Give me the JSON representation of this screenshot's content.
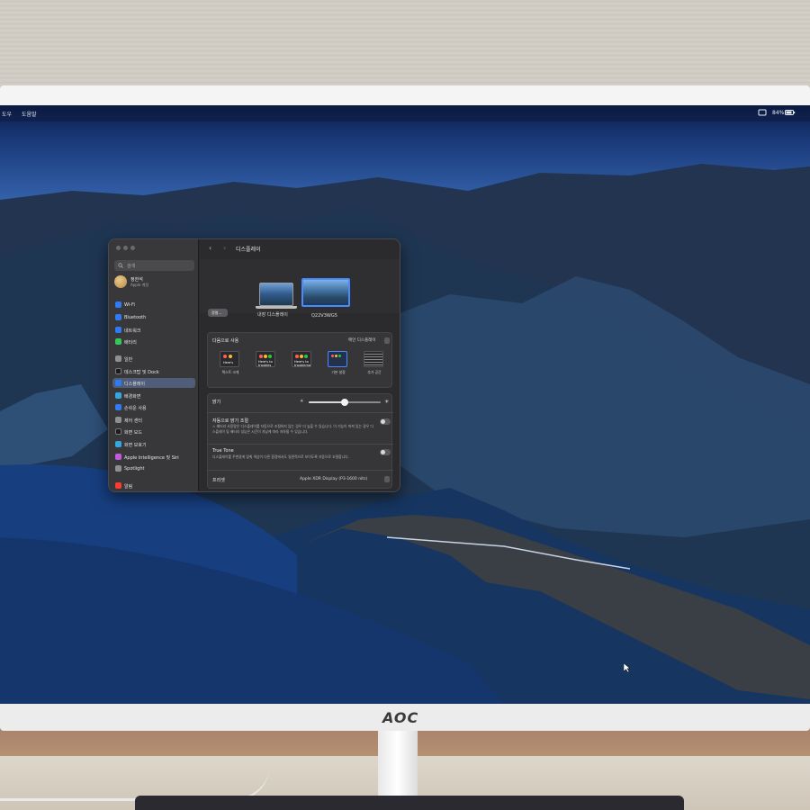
{
  "menubar": {
    "left_items": [
      "도우",
      "도움말"
    ],
    "battery": "84%",
    "icons": [
      "control-center-icon",
      "battery-icon"
    ]
  },
  "monitor": {
    "brand": "AOC"
  },
  "window": {
    "title": "디스플레이",
    "search_placeholder": "검색",
    "profile": {
      "name": "정한석",
      "subtitle": "Apple 계정"
    },
    "sidebar_items": [
      {
        "label": "Wi-Fi",
        "icon": "wifi-icon",
        "color": "#2d7cf6"
      },
      {
        "label": "Bluetooth",
        "icon": "bluetooth-icon",
        "color": "#2d7cf6"
      },
      {
        "label": "네트워크",
        "icon": "network-icon",
        "color": "#2d7cf6"
      },
      {
        "label": "배터리",
        "icon": "battery-icon",
        "color": "#34c759"
      },
      {
        "label": "일반",
        "icon": "gear-icon",
        "color": "#8e8e93"
      },
      {
        "label": "데스크탑 및 Dock",
        "icon": "dock-icon",
        "color": "#1c1c1e"
      },
      {
        "label": "디스플레이",
        "icon": "display-icon",
        "color": "#2d7cf6",
        "selected": true
      },
      {
        "label": "배경화면",
        "icon": "wallpaper-icon",
        "color": "#35a7e0"
      },
      {
        "label": "손쉬운 사용",
        "icon": "accessibility-icon",
        "color": "#2d7cf6"
      },
      {
        "label": "제어 센터",
        "icon": "control-center-icon",
        "color": "#8e8e93"
      },
      {
        "label": "화면 모드",
        "icon": "appearance-icon",
        "color": "#1c1c1e"
      },
      {
        "label": "화면 보호기",
        "icon": "screensaver-icon",
        "color": "#35a7e0"
      },
      {
        "label": "Apple Intelligence 및 Siri",
        "icon": "siri-icon",
        "color": "#c05be0"
      },
      {
        "label": "Spotlight",
        "icon": "spotlight-icon",
        "color": "#8e8e93"
      },
      {
        "label": "알림",
        "icon": "notifications-icon",
        "color": "#ff3b30"
      }
    ],
    "displays": [
      {
        "label": "내장 디스플레이"
      },
      {
        "label": "Q22V3WG5"
      }
    ],
    "arrange_button": "정렬...",
    "use_as": {
      "label": "다음으로 사용",
      "value": "메인 디스플레이"
    },
    "resolution_options": [
      {
        "label": "텍스트 크게",
        "preview": "Here's"
      },
      {
        "label": "",
        "preview": "Here's to troubles"
      },
      {
        "label": "",
        "preview": "Here's to troublema"
      },
      {
        "label": "기본 설정",
        "preview": "",
        "selected": true
      },
      {
        "label": "추가 공간",
        "preview": ""
      }
    ],
    "brightness": {
      "label": "밝기",
      "level": 0.5
    },
    "auto_brightness": {
      "label": "자동으로 밝기 조절",
      "description": "⚠ 배터리 사용량은 디스플레이를 자동으로 조절하지 않는 경우 더 높을 수 있습니다. 이 기능이 꺼져 있는 경우 디스플레이 및 배터리 성능은 시간이 지남에 따라 저하될 수 있습니다.",
      "enabled": false
    },
    "true_tone": {
      "label": "True Tone",
      "description": "디스플레이를 주변광에 맞춰 색상이 다른 환경에서도 일관적으로 보이도록 자동으로 조절합니다.",
      "enabled": false
    },
    "preset": {
      "label": "프리셋",
      "value": "Apple XDR Display (P3-1600 nits)"
    }
  }
}
